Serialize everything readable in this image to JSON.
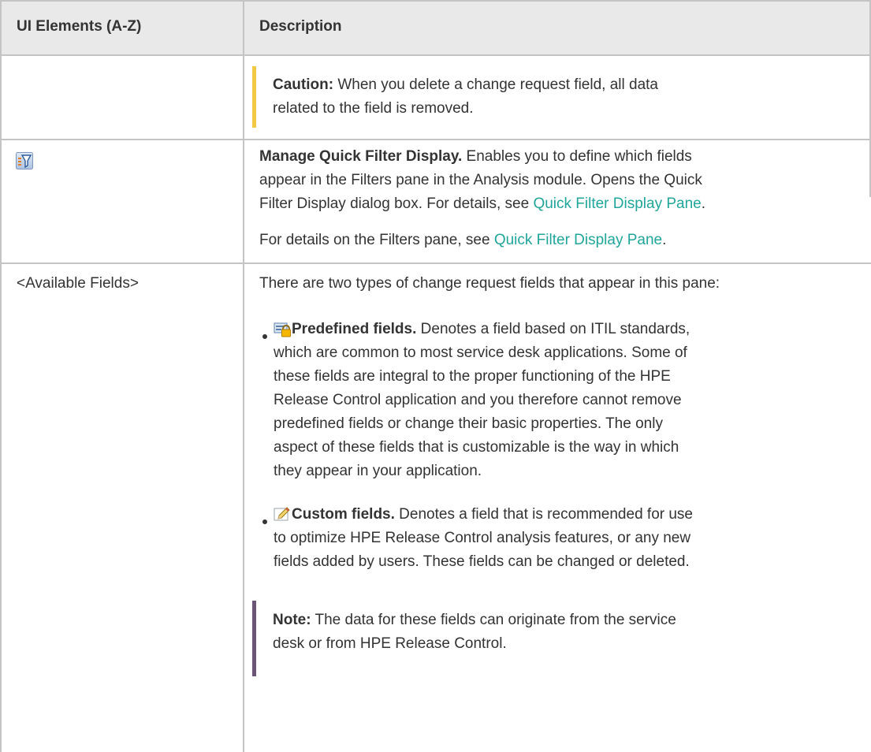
{
  "colors": {
    "header_bg": "#e9e9e9",
    "border": "#c4c4c4",
    "link": "#20a59a",
    "caution_bar": "#f3c845",
    "note_bar": "#6b5577",
    "text": "#333333"
  },
  "table": {
    "headers": {
      "col1": "UI Elements (A-Z)",
      "col2": "Description"
    },
    "caution": {
      "label": "Caution:",
      "line1": " When you delete a change request field, all data",
      "line2": "related to the field is removed."
    },
    "quick_filter": {
      "icon": "manage-quick-filter-icon",
      "title": "Manage Quick Filter Display.",
      "line1": " Enables you to define which fields",
      "line2": "appear in the Filters pane in the Analysis module. Opens the Quick",
      "line3_pre": "Filter Display dialog box. For details, see ",
      "link1": "Quick Filter Display Pane",
      "line3_post": ".",
      "para2_pre": "For details on the Filters pane, see ",
      "link2": "Quick Filter Display Pane",
      "para2_post": "."
    },
    "available_fields": {
      "element_label": "<Available Fields>",
      "intro": "There are two types of change request fields that appear in this pane:",
      "predefined": {
        "icon": "locked-field-icon",
        "title": "Predefined fields.",
        "line1": " Denotes a field based on ITIL standards,",
        "line2": "which are common to most service desk applications. Some of",
        "line3": "these fields are integral to the proper functioning of the HPE",
        "line4": "Release Control application and you therefore cannot remove",
        "line5": "predefined fields or change their basic properties. The only",
        "line6": "aspect of these fields that is customizable is the way in which",
        "line7": "they appear in your application."
      },
      "custom": {
        "icon": "pencil-icon",
        "title": "Custom fields.",
        "line1": " Denotes a field that is recommended for use",
        "line2": "to optimize HPE Release Control analysis features, or any new",
        "line3": "fields added by users. These fields can be changed or deleted."
      },
      "note": {
        "label": "Note:",
        "line1": " The data for these fields can originate from the service",
        "line2": "desk or from HPE Release Control."
      }
    }
  }
}
